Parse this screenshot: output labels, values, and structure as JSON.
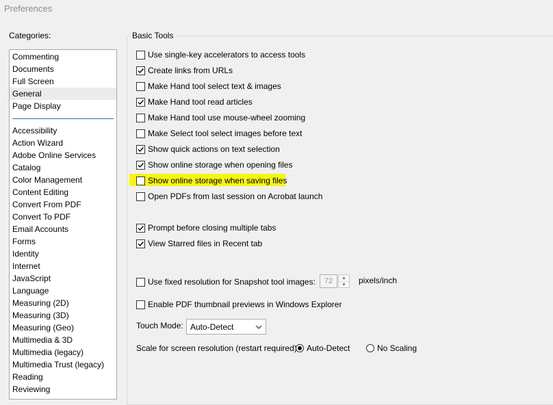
{
  "window": {
    "title": "Preferences"
  },
  "categories": {
    "label": "Categories:",
    "top_items": [
      "Commenting",
      "Documents",
      "Full Screen",
      "General",
      "Page Display"
    ],
    "selected": "General",
    "items": [
      "Accessibility",
      "Action Wizard",
      "Adobe Online Services",
      "Catalog",
      "Color Management",
      "Content Editing",
      "Convert From PDF",
      "Convert To PDF",
      "Email Accounts",
      "Forms",
      "Identity",
      "Internet",
      "JavaScript",
      "Language",
      "Measuring (2D)",
      "Measuring (3D)",
      "Measuring (Geo)",
      "Multimedia & 3D",
      "Multimedia (legacy)",
      "Multimedia Trust (legacy)",
      "Reading",
      "Reviewing"
    ]
  },
  "basic_tools": {
    "label": "Basic Tools",
    "options": [
      {
        "label": "Use single-key accelerators to access tools",
        "checked": false
      },
      {
        "label": "Create links from URLs",
        "checked": true
      },
      {
        "label": "Make Hand tool select text & images",
        "checked": false
      },
      {
        "label": "Make Hand tool read articles",
        "checked": true
      },
      {
        "label": "Make Hand tool use mouse-wheel zooming",
        "checked": false
      },
      {
        "label": "Make Select tool select images before text",
        "checked": false
      },
      {
        "label": "Show quick actions on text selection",
        "checked": true
      },
      {
        "label": "Show online storage when opening files",
        "checked": true
      },
      {
        "label": "Show online storage when saving files",
        "checked": false,
        "highlighted": true
      },
      {
        "label": "Open PDFs from last session on Acrobat launch",
        "checked": false
      },
      {
        "label": "Prompt before closing multiple tabs",
        "checked": true
      },
      {
        "label": "View Starred files in Recent tab",
        "checked": true
      },
      {
        "label": "Use fixed resolution for Snapshot tool images:",
        "checked": false
      },
      {
        "label": "Enable PDF thumbnail previews in Windows Explorer",
        "checked": false
      }
    ],
    "snapshot_resolution": {
      "value": "72",
      "unit": "pixels/inch"
    },
    "touch_mode": {
      "label": "Touch Mode:",
      "value": "Auto-Detect"
    },
    "scale": {
      "label": "Scale for screen resolution (restart required):",
      "options": [
        {
          "label": "Auto-Detect",
          "selected": true
        },
        {
          "label": "No Scaling",
          "selected": false
        }
      ]
    }
  },
  "colors": {
    "highlight": "#f6f615",
    "divider": "#1c72b8",
    "selection": "#ececec"
  }
}
